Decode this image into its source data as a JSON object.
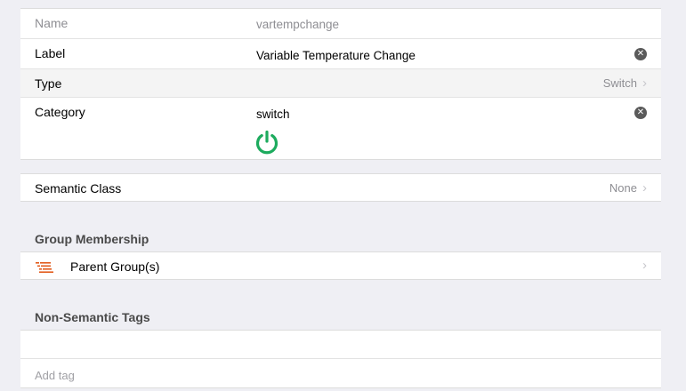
{
  "fields": {
    "name_label": "Name",
    "name_value": "vartempchange",
    "label_label": "Label",
    "label_value": "Variable Temperature Change",
    "type_label": "Type",
    "type_value": "Switch",
    "category_label": "Category",
    "category_value": "switch"
  },
  "semantic": {
    "label": "Semantic Class",
    "value": "None"
  },
  "group_membership": {
    "title": "Group Membership",
    "parent_groups_label": "Parent Group(s)"
  },
  "tags": {
    "title": "Non-Semantic Tags",
    "add_placeholder": "Add tag"
  },
  "colors": {
    "accent_green": "#1dab5e",
    "group_icon": "#e25b1c",
    "background": "#efeff4"
  },
  "icons": {
    "clear": "clear-icon",
    "chevron": "chevron-right-icon",
    "category": "power-icon",
    "group": "list-icon"
  }
}
